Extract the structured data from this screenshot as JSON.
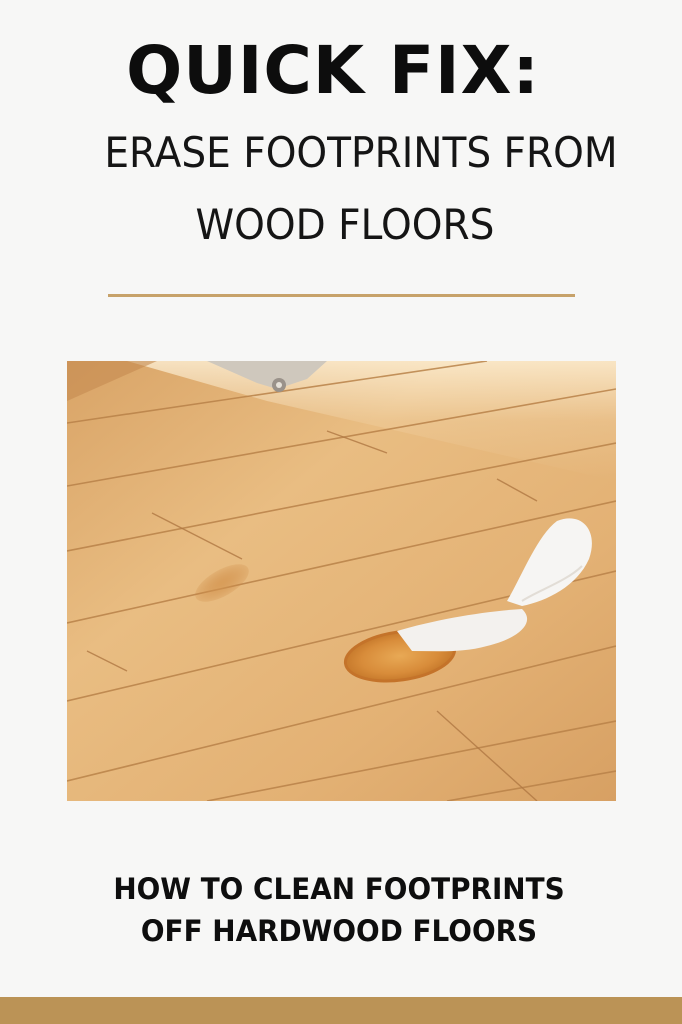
{
  "headline": "QUICK FIX:",
  "subtitle": {
    "line1": "ERASE FOOTPRINTS FROM",
    "line2": "WOOD FLOORS"
  },
  "image": {
    "subject": "footprint-stained-hardwood-floor-photo"
  },
  "caption": {
    "line1": "HOW TO CLEAN FOOTPRINTS",
    "line2": "OFF HARDWOOD FLOORS"
  },
  "colors": {
    "background": "#f7f7f6",
    "accent_rule": "#c7a26a",
    "footer_bar": "#bb9356",
    "text": "#111111",
    "wood_light": "#e6b87c",
    "wood_dark": "#c98f4f"
  }
}
